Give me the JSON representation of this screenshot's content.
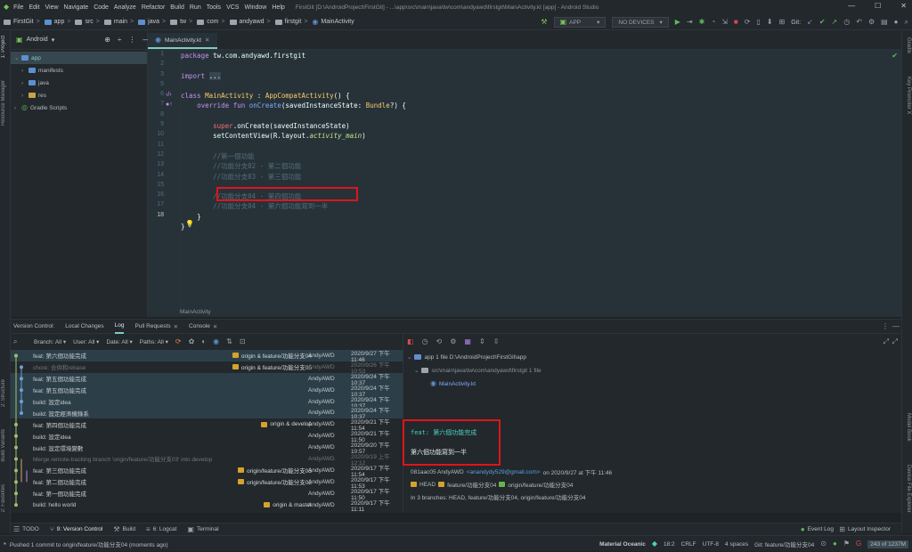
{
  "menu": {
    "items": [
      "File",
      "Edit",
      "View",
      "Navigate",
      "Code",
      "Analyze",
      "Refactor",
      "Build",
      "Run",
      "Tools",
      "VCS",
      "Window",
      "Help"
    ],
    "title": "FirstGit [D:\\AndroidProject\\FirstGit] - ...\\app\\src\\main\\java\\tw\\com\\andyawd\\firstgit\\MainActivity.kt [app] - Android Studio"
  },
  "window": {
    "minimize": "—",
    "maximize": "☐",
    "close": "✕"
  },
  "breadcrumb": [
    "FirstGit",
    "app",
    "src",
    "main",
    "java",
    "tw",
    "com",
    "andyawd",
    "firstgit",
    "MainActivity"
  ],
  "toolbar": {
    "config": "APP",
    "device": "NO DEVICES",
    "git_label": "Git:"
  },
  "project": {
    "view": "Android",
    "items": [
      {
        "label": "app",
        "level": 0,
        "selected": true
      },
      {
        "label": "manifests",
        "level": 1
      },
      {
        "label": "java",
        "level": 1
      },
      {
        "label": "res",
        "level": 1
      },
      {
        "label": "Gradle Scripts",
        "level": 0
      }
    ]
  },
  "left_strip": {
    "project": "1: Project",
    "resource_manager": "Resource Manager",
    "structure": "2: Structure",
    "build_variants": "Build Variants",
    "favorites": "2: Favorites"
  },
  "right_strip": {
    "gradle": "Gradle",
    "key_promoter": "Key Promoter X",
    "model_book": "Model Book",
    "device_file_explorer": "Device File Explorer"
  },
  "editor": {
    "tab": "MainActivity.kt",
    "footer": "MainActivity",
    "lines": [
      "1",
      "2",
      "3",
      "6",
      "7",
      "9",
      "10",
      "11",
      "12",
      "13",
      "14",
      "15",
      "16",
      "17",
      "18"
    ],
    "code": {
      "l1a": "package ",
      "l1b": "tw.com.andyawd.firstgit",
      "l3a": "import ",
      "l3b": "...",
      "l6a": "class ",
      "l6b": "MainActivity",
      "l6c": " : ",
      "l6d": "AppCompatActivity",
      "l6e": "() {",
      "l7a": "override fun ",
      "l7b": "onCreate",
      "l7c": "(savedInstanceState: ",
      "l7d": "Bundle",
      "l7e": "?) {",
      "l9a": "super",
      "l9b": ".onCreate(savedInstanceState)",
      "l10a": "setContentView(R.layout.",
      "l10b": "activity_main",
      "l10c": ")",
      "c12": "//第一個功能",
      "c13": "//功能分支02 - 第二個功能",
      "c14": "//功能分支03 - 第三個功能",
      "c15": "//功能分支04 - 第四個功能",
      "c16": "//功能分支04 - 第六個功能寫到一半",
      "l17": "}",
      "l18": "}"
    }
  },
  "vcs": {
    "tabs": [
      "Version Control:",
      "Local Changes",
      "Log",
      "Pull Requests",
      "Console"
    ],
    "filters": {
      "branch": "Branch: All",
      "user": "User: All",
      "date": "Date: All",
      "paths": "Paths: All"
    },
    "commits": [
      {
        "msg": "feat: 第六個功能完成",
        "refs": "origin & feature/功能分支04",
        "author": "AndyAWD",
        "date": "2020/9/27 下午 11:46",
        "hl": true
      },
      {
        "msg": "chore: 合併和rebase",
        "refs": "origin & feature/功能分支05",
        "author": "AndyAWD",
        "date": "2020/9/26 下午 10:53",
        "dim": true
      },
      {
        "msg": "feat: 第五個功能完成",
        "author": "AndyAWD",
        "date": "2020/9/24 下午 10:37",
        "hl": true
      },
      {
        "msg": "feat: 第五個功能完成",
        "author": "AndyAWD",
        "date": "2020/9/24 下午 10:37",
        "hl": true
      },
      {
        "msg": "build: 設定idea",
        "author": "AndyAWD",
        "date": "2020/9/24 下午 10:37",
        "hl": true
      },
      {
        "msg": "build: 設定經濟機錄系",
        "author": "AndyAWD",
        "date": "2020/9/24 下午 10:37",
        "hl": true
      },
      {
        "msg": "feat: 第四個功能完成",
        "refs": "origin & develop",
        "author": "AndyAWD",
        "date": "2020/9/21 下午 11:54"
      },
      {
        "msg": "build: 設定idea",
        "author": "AndyAWD",
        "date": "2020/9/21 下午 11:50"
      },
      {
        "msg": "build: 設定環境變數",
        "author": "AndyAWD",
        "date": "2020/9/20 下午 10:57"
      },
      {
        "msg": "Merge remote-tracking branch 'origin/feature/功能分支03' into develop",
        "author": "AndyAWD",
        "date": "2020/9/19 上午 12:12",
        "dim": true
      },
      {
        "msg": "feat: 第三個功能完成",
        "refs": "origin/feature/功能分支03",
        "author": "AndyAWD",
        "date": "2020/9/17 下午 11:54"
      },
      {
        "msg": "feat: 第二個功能完成",
        "refs": "origin/feature/功能分支02",
        "author": "AndyAWD",
        "date": "2020/9/17 下午 11:53"
      },
      {
        "msg": "feat: 第一個功能完成",
        "author": "AndyAWD",
        "date": "2020/9/17 下午 11:50"
      },
      {
        "msg": "build: hello world",
        "refs": "origin & master",
        "author": "AndyAWD",
        "date": "2020/9/17 下午 11:11"
      }
    ]
  },
  "detail": {
    "root": "app 1 file D:\\AndroidProject\\FirstGit\\app",
    "path": "src\\main\\java\\tw\\com\\andyawd\\firstgit 1 file",
    "file": "MainActivity.kt",
    "title": "feat: 第六個功能完成",
    "body": "第六個功能寫到一半",
    "meta_hash": "081aac05 AndyAWD",
    "meta_email": "<anandydy529@gmail.com>",
    "meta_date": "on 2020/9/27 at 下午 11:46",
    "head_refs": [
      "HEAD",
      "feature/功能分支04",
      "origin/feature/功能分支04"
    ],
    "branches": "In 3 branches: HEAD, feature/功能分支04, origin/feature/功能分支04"
  },
  "bottom_tabs": [
    "TODO",
    "9: Version Control",
    "Build",
    "6: Logcat",
    "Terminal"
  ],
  "bottom_right": {
    "event_log": "Event Log",
    "layout_inspector": "Layout Inspector"
  },
  "status": {
    "message": "Pushed 1 commit to origin/feature/功能分支04 (moments ago)",
    "theme": "Material Oceanic",
    "pos": "18:2",
    "crlf": "CRLF",
    "enc": "UTF-8",
    "indent": "4 spaces",
    "git": "Git: feature/功能分支04",
    "mem": "243 of 1237M"
  },
  "colors": {
    "accent": "#80cbc4",
    "highlight_box": "#e0141a",
    "tag": "#d4a32d"
  }
}
